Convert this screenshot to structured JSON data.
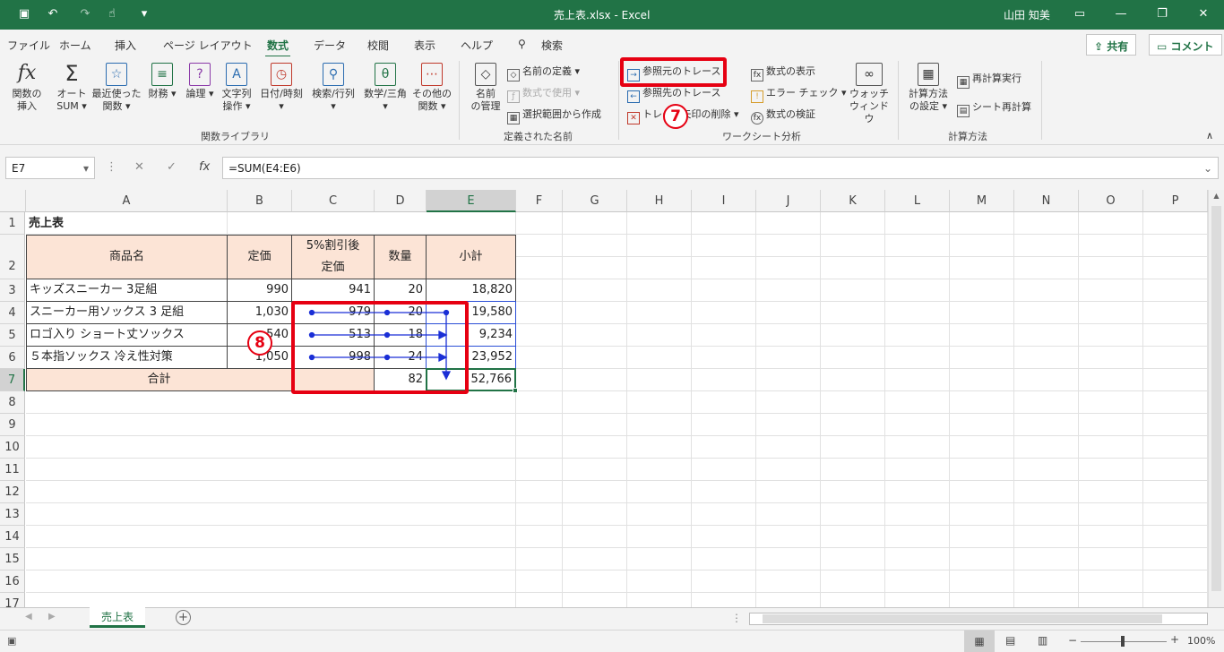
{
  "title": {
    "file": "売上表.xlsx",
    "sep": "-",
    "app": "Excel",
    "user": "山田 知美"
  },
  "menu": [
    "ファイル",
    "ホーム",
    "挿入",
    "ページ レイアウト",
    "数式",
    "データ",
    "校閲",
    "表示",
    "ヘルプ",
    "検索"
  ],
  "share": "共有",
  "comment": "コメント",
  "ribbon": {
    "insert_fn": [
      "関数の",
      "挿入"
    ],
    "autosum": [
      "オート",
      "SUM"
    ],
    "recent": [
      "最近使った",
      "関数"
    ],
    "finance": "財務",
    "logic": "論理",
    "text": [
      "文字列",
      "操作"
    ],
    "datetime": "日付/時刻",
    "lookup": "検索/行列",
    "math": "数学/三角",
    "more": [
      "その他の",
      "関数"
    ],
    "group_lib": "関数ライブラリ",
    "name_mgr": [
      "名前",
      "の管理"
    ],
    "define_name": "名前の定義",
    "use_in_formula": "数式で使用",
    "create_from_sel": "選択範囲から作成",
    "group_names": "定義された名前",
    "trace_prec": "参照元のトレース",
    "trace_dep": "参照先のトレース",
    "remove_arrows": "トレース矢印の削除",
    "show_formulas": "数式の表示",
    "error_check": "エラー チェック",
    "eval_formula": "数式の検証",
    "watch": [
      "ウォッチ",
      "ウィンドウ"
    ],
    "group_audit": "ワークシート分析",
    "calc_opts": [
      "計算方法",
      "の設定"
    ],
    "calc_now": "再計算実行",
    "calc_sheet": "シート再計算",
    "group_calc": "計算方法"
  },
  "namebox": "E7",
  "formula": "=SUM(E4:E6)",
  "columns": [
    "A",
    "B",
    "C",
    "D",
    "E",
    "F",
    "G",
    "H",
    "I",
    "J",
    "K",
    "L",
    "M",
    "N",
    "O",
    "P"
  ],
  "rows": [
    "1",
    "2",
    "3",
    "4",
    "5",
    "6",
    "7",
    "8",
    "9",
    "10",
    "11",
    "12",
    "13",
    "14",
    "15",
    "16",
    "17"
  ],
  "sheet": {
    "title": "売上表",
    "h_name": "商品名",
    "h_price": "定価",
    "h_disc1": "5%割引後",
    "h_disc2": "定価",
    "h_qty": "数量",
    "h_sub": "小計",
    "data": [
      [
        "キッズスニーカー 3足組",
        "990",
        "941",
        "20",
        "18,820"
      ],
      [
        "スニーカー用ソックス 3 足組",
        "1,030",
        "979",
        "20",
        "19,580"
      ],
      [
        "ロゴ入り ショート丈ソックス",
        "540",
        "513",
        "18",
        "9,234"
      ],
      [
        "５本指ソックス 冷え性対策",
        "1,050",
        "998",
        "24",
        "23,952"
      ]
    ],
    "total_label": "合計",
    "total_qty": "82",
    "total_sub": "52,766"
  },
  "tab": "売上表",
  "zoom": "100%",
  "badges": {
    "b7": "7",
    "b8": "8"
  }
}
